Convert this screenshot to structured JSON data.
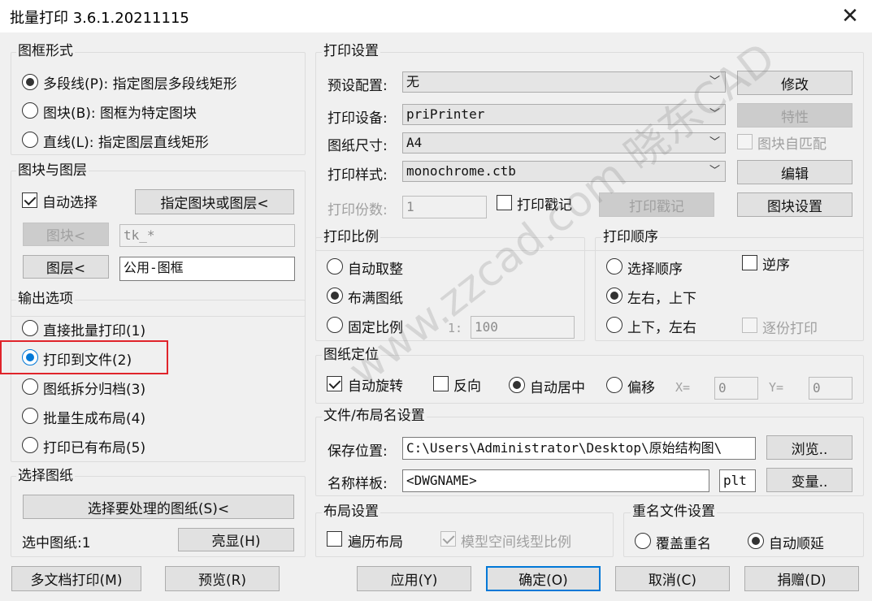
{
  "window": {
    "title": "批量打印 3.6.1.20211115",
    "close_glyph": "✕"
  },
  "frame_form": {
    "title": "图框形式",
    "options": [
      {
        "label": "多段线(P): 指定图层多段线矩形",
        "selected": true
      },
      {
        "label": "图块(B): 图框为特定图块",
        "selected": false
      },
      {
        "label": "直线(L): 指定图层直线矩形",
        "selected": false
      }
    ]
  },
  "block_layer": {
    "title": "图块与图层",
    "auto_select_label": "自动选择",
    "auto_select_checked": true,
    "specify_button": "指定图块或图层<",
    "block_button": "图块<",
    "block_value": "tk_*",
    "layer_button": "图层<",
    "layer_value": "公用-图框"
  },
  "output": {
    "title": "输出选项",
    "options": [
      {
        "label": "直接批量打印(1)",
        "selected": false
      },
      {
        "label": "打印到文件(2)",
        "selected": true
      },
      {
        "label": "图纸拆分归档(3)",
        "selected": false
      },
      {
        "label": "批量生成布局(4)",
        "selected": false
      },
      {
        "label": "打印已有布局(5)",
        "selected": false
      }
    ]
  },
  "select_paper": {
    "title": "选择图纸",
    "select_button": "选择要处理的图纸(S)<",
    "selected_label": "选中图纸:1",
    "highlight_button": "亮显(H)"
  },
  "print_settings": {
    "title": "打印设置",
    "preset_label": "预设配置:",
    "preset_value": "无",
    "modify_button": "修改",
    "device_label": "打印设备:",
    "device_value": "priPrinter",
    "properties_button": "特性",
    "paper_label": "图纸尺寸:",
    "paper_value": "A4",
    "auto_match_label": "图块自匹配",
    "style_label": "打印样式:",
    "style_value": "monochrome.ctb",
    "edit_button": "编辑",
    "copies_label": "打印份数:",
    "copies_value": "1",
    "stamp_check_label": "打印戳记",
    "stamp_button": "打印戳记",
    "block_settings_button": "图块设置"
  },
  "scale": {
    "title": "打印比例",
    "auto_fit": "自动取整",
    "fill_paper": "布满图纸",
    "fixed": "固定比例",
    "ratio_prefix": "1:",
    "ratio_value": "100",
    "selected": "fill_paper"
  },
  "order": {
    "title": "打印顺序",
    "select_order": "选择顺序",
    "reverse": "逆序",
    "lr_tb": "左右，上下",
    "tb_lr": "上下，左右",
    "copy_print": "逐份打印",
    "selected": "lr_tb"
  },
  "position": {
    "title": "图纸定位",
    "auto_rotate": "自动旋转",
    "auto_rotate_checked": true,
    "reverse": "反向",
    "auto_center": "自动居中",
    "offset": "偏移",
    "x_label": "X=",
    "x_value": "0",
    "y_label": "Y=",
    "y_value": "0"
  },
  "file_naming": {
    "title": "文件/布局名设置",
    "save_label": "保存位置:",
    "save_value": "C:\\Users\\Administrator\\Desktop\\原始结构图\\",
    "browse_button": "浏览..",
    "template_label": "名称样板:",
    "template_value": "<DWGNAME>",
    "ext_value": "plt",
    "variable_button": "变量.."
  },
  "layout_settings": {
    "title": "布局设置",
    "iterate_label": "遍历布局",
    "linetype_label": "模型空间线型比例"
  },
  "rename": {
    "title": "重名文件设置",
    "overwrite": "覆盖重名",
    "auto_suffix": "自动顺延",
    "selected": "auto_suffix"
  },
  "bottom": {
    "multi_doc": "多文档打印(M)",
    "preview": "预览(R)",
    "apply": "应用(Y)",
    "ok": "确定(O)",
    "cancel": "取消(C)",
    "donate": "捐赠(D)"
  },
  "watermark": "www.zzcad.com 晓东CAD"
}
